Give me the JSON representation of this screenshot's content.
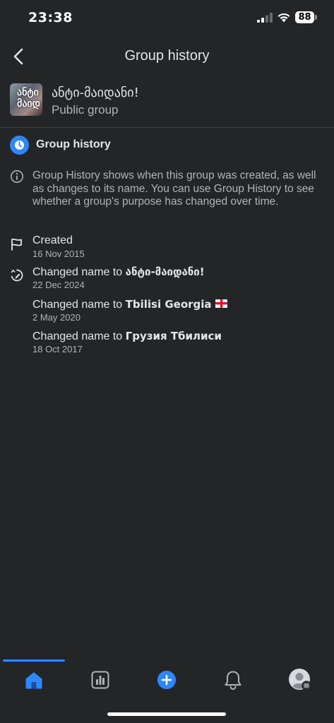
{
  "status_bar": {
    "time": "23:38",
    "battery": "88"
  },
  "header": {
    "title": "Group history"
  },
  "group": {
    "name": "ანტი-მაიდანი!",
    "type": "Public group",
    "thumbnail_text": "ანტი მაიდ"
  },
  "section": {
    "title": "Group history",
    "description": "Group History shows when this group was created, as well as changes to its name. You can use Group History to see whether a group's purpose has changed over time."
  },
  "history": [
    {
      "prefix": "Created",
      "name": "",
      "date": "16 Nov 2015",
      "icon": "flag-icon"
    },
    {
      "prefix": "Changed name to ",
      "name": "ანტი-მაიდანი!",
      "date": "22 Dec 2024",
      "icon": "edit-history-icon"
    },
    {
      "prefix": "Changed name to ",
      "name": "Tbilisi Georgia",
      "date": "2 May 2020",
      "icon": ""
    },
    {
      "prefix": "Changed name to ",
      "name": "Грузия Тбилиси",
      "date": "18 Oct 2017",
      "icon": ""
    }
  ],
  "tab_bar": {
    "items": [
      "home-icon",
      "dashboard-icon",
      "create-icon",
      "notifications-icon",
      "profile-icon"
    ],
    "active": "home-icon"
  },
  "colors": {
    "accent": "#2d88ff",
    "background": "#242526",
    "primary_text": "#e4e6eb",
    "secondary_text": "#b0b3b8"
  }
}
